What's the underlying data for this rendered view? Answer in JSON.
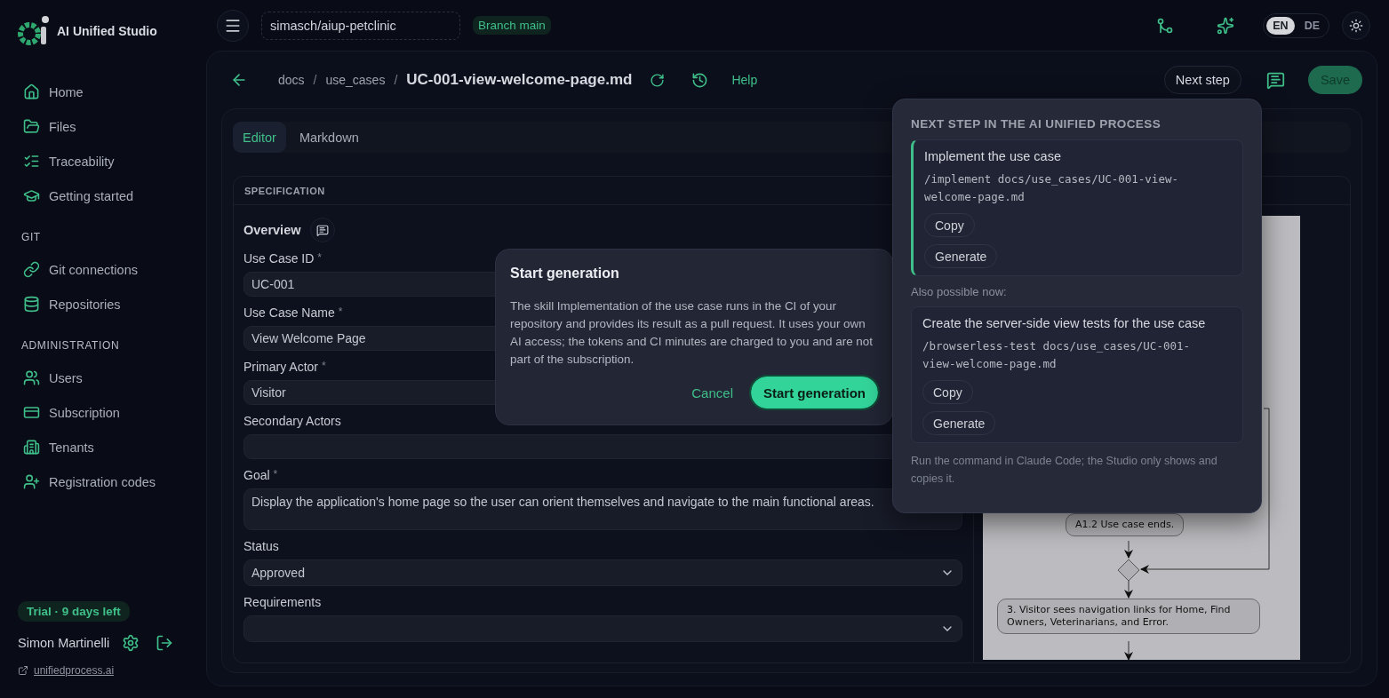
{
  "app": {
    "name": "AI Unified Studio"
  },
  "sidebar": {
    "sections": [
      {
        "items": [
          {
            "label": "Home"
          },
          {
            "label": "Files"
          },
          {
            "label": "Traceability"
          },
          {
            "label": "Getting started"
          }
        ]
      },
      {
        "heading": "GIT",
        "items": [
          {
            "label": "Git connections"
          },
          {
            "label": "Repositories"
          }
        ]
      },
      {
        "heading": "ADMINISTRATION",
        "items": [
          {
            "label": "Users"
          },
          {
            "label": "Subscription"
          },
          {
            "label": "Tenants"
          },
          {
            "label": "Registration codes"
          }
        ]
      }
    ],
    "trial_badge": "Trial · 9 days left",
    "user_name": "Simon Martinelli",
    "footer_link": "unifiedprocess.ai"
  },
  "topbar": {
    "repository": "simasch/aiup-petclinic",
    "branch": "Branch main",
    "languages": [
      {
        "label": "EN",
        "selected": true
      },
      {
        "label": "DE",
        "selected": false
      }
    ]
  },
  "header": {
    "breadcrumb": [
      "docs",
      "use_cases"
    ],
    "separator": "/",
    "file": "UC-001-view-welcome-page.md",
    "help": "Help",
    "next_step": "Next step",
    "save": {
      "label": "Save",
      "disabled": true
    }
  },
  "tabs": [
    {
      "label": "Editor",
      "selected": true
    },
    {
      "label": "Markdown",
      "selected": false
    }
  ],
  "specification": {
    "heading": "SPECIFICATION",
    "section": "Overview",
    "fields": [
      {
        "label": "Use Case ID",
        "marker": "*",
        "kind": "input",
        "value": "UC-001"
      },
      {
        "label": "Use Case Name",
        "marker": "*",
        "kind": "input",
        "value": "View Welcome Page"
      },
      {
        "label": "Primary Actor",
        "marker": "*",
        "kind": "input",
        "value": "Visitor"
      },
      {
        "label": "Secondary Actors",
        "kind": "input"
      },
      {
        "label": "Goal",
        "marker": "*",
        "kind": "textarea",
        "value": "Display the application's home page so the user can orient themselves and navigate to the main functional areas."
      },
      {
        "label": "Status",
        "kind": "select",
        "value": "Approved"
      },
      {
        "label": "Requirements",
        "kind": "select"
      }
    ]
  },
  "diagram": {
    "nodes": [
      {
        "label": "A1.2 Use case ends."
      },
      {
        "label": "3. Visitor sees navigation links for Home, Find Owners, Veterinarians, and Error."
      }
    ]
  },
  "next_step_popover": {
    "title": "NEXT STEP IN THE AI UNIFIED PROCESS",
    "steps": [
      {
        "kind": "primary",
        "title": "Implement the use case",
        "command": "/implement docs/use_cases/UC-001-view-welcome-page.md",
        "actions": [
          "Copy",
          "Generate"
        ]
      },
      {
        "kind": "alternative",
        "title": "Create the server-side view tests for the use case",
        "command": "/browserless-test docs/use_cases/UC-001-view-welcome-page.md",
        "actions": [
          "Copy",
          "Generate"
        ]
      }
    ],
    "also_label": "Also possible now:",
    "note": "Run the command in Claude Code; the Studio only shows and copies it."
  },
  "dialog": {
    "title": "Start generation",
    "body": "The skill Implementation of the use case runs in the CI of your repository and provides its result as a pull request. It uses your own AI access; the tokens and CI minutes are charged to you and are not part of the subscription.",
    "cancel": "Cancel",
    "confirm": "Start generation"
  }
}
